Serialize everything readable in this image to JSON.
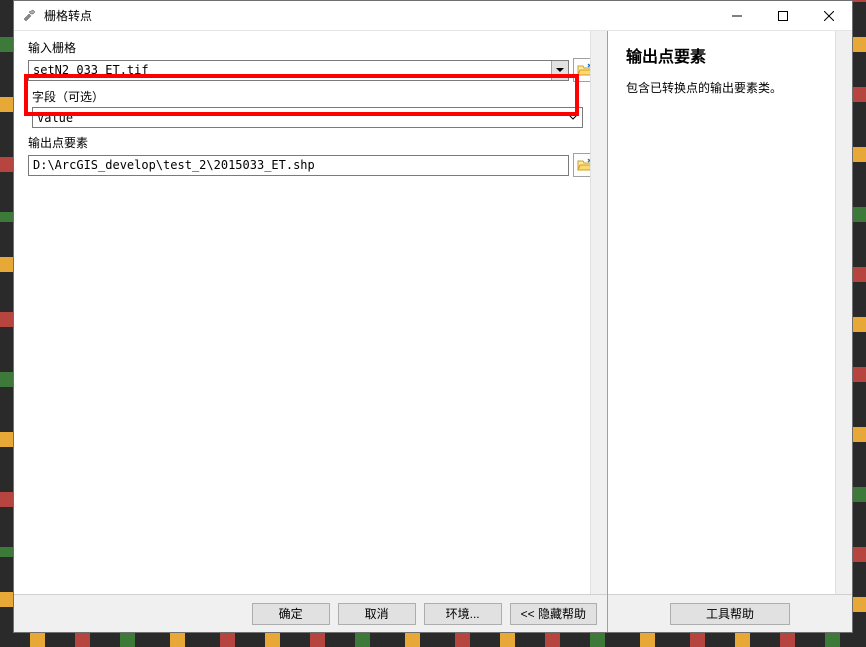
{
  "window": {
    "title": "栅格转点"
  },
  "form": {
    "input_raster": {
      "label": "输入栅格",
      "value": "setN2_033_ET.tif"
    },
    "field": {
      "label": "字段（可选）",
      "value": "Value"
    },
    "output_point": {
      "label": "输出点要素",
      "value": "D:\\ArcGIS_develop\\test_2\\2015033_ET.shp"
    }
  },
  "buttons": {
    "ok": "确定",
    "cancel": "取消",
    "environments": "环境...",
    "hide_help": "<< 隐藏帮助",
    "tool_help": "工具帮助"
  },
  "help": {
    "title": "输出点要素",
    "text": "包含已转换点的输出要素类。"
  }
}
